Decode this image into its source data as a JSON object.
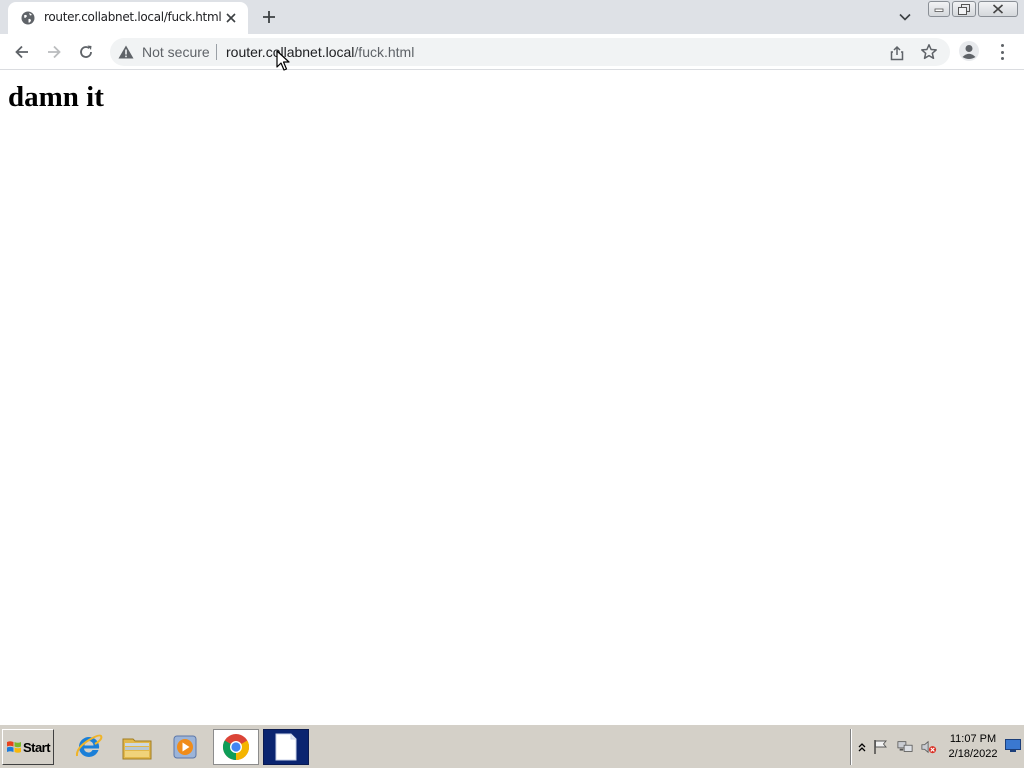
{
  "browser": {
    "tab": {
      "title": "router.collabnet.local/fuck.html",
      "icon": "globe-icon"
    },
    "toolbar": {
      "security_label": "Not secure",
      "url_host": "router.collabnet.local",
      "url_path": "/fuck.html"
    }
  },
  "page": {
    "heading": "damn it"
  },
  "taskbar": {
    "start_label": "Start",
    "apps": [
      "internet-explorer-icon",
      "file-explorer-icon",
      "media-player-icon",
      "chrome-icon",
      "document-icon"
    ],
    "clock": {
      "time": "11:07 PM",
      "date": "2/18/2022"
    }
  },
  "colors": {
    "tabstrip": "#dee1e6",
    "omnibox": "#f1f3f4",
    "taskbar": "#d4d0c8"
  }
}
